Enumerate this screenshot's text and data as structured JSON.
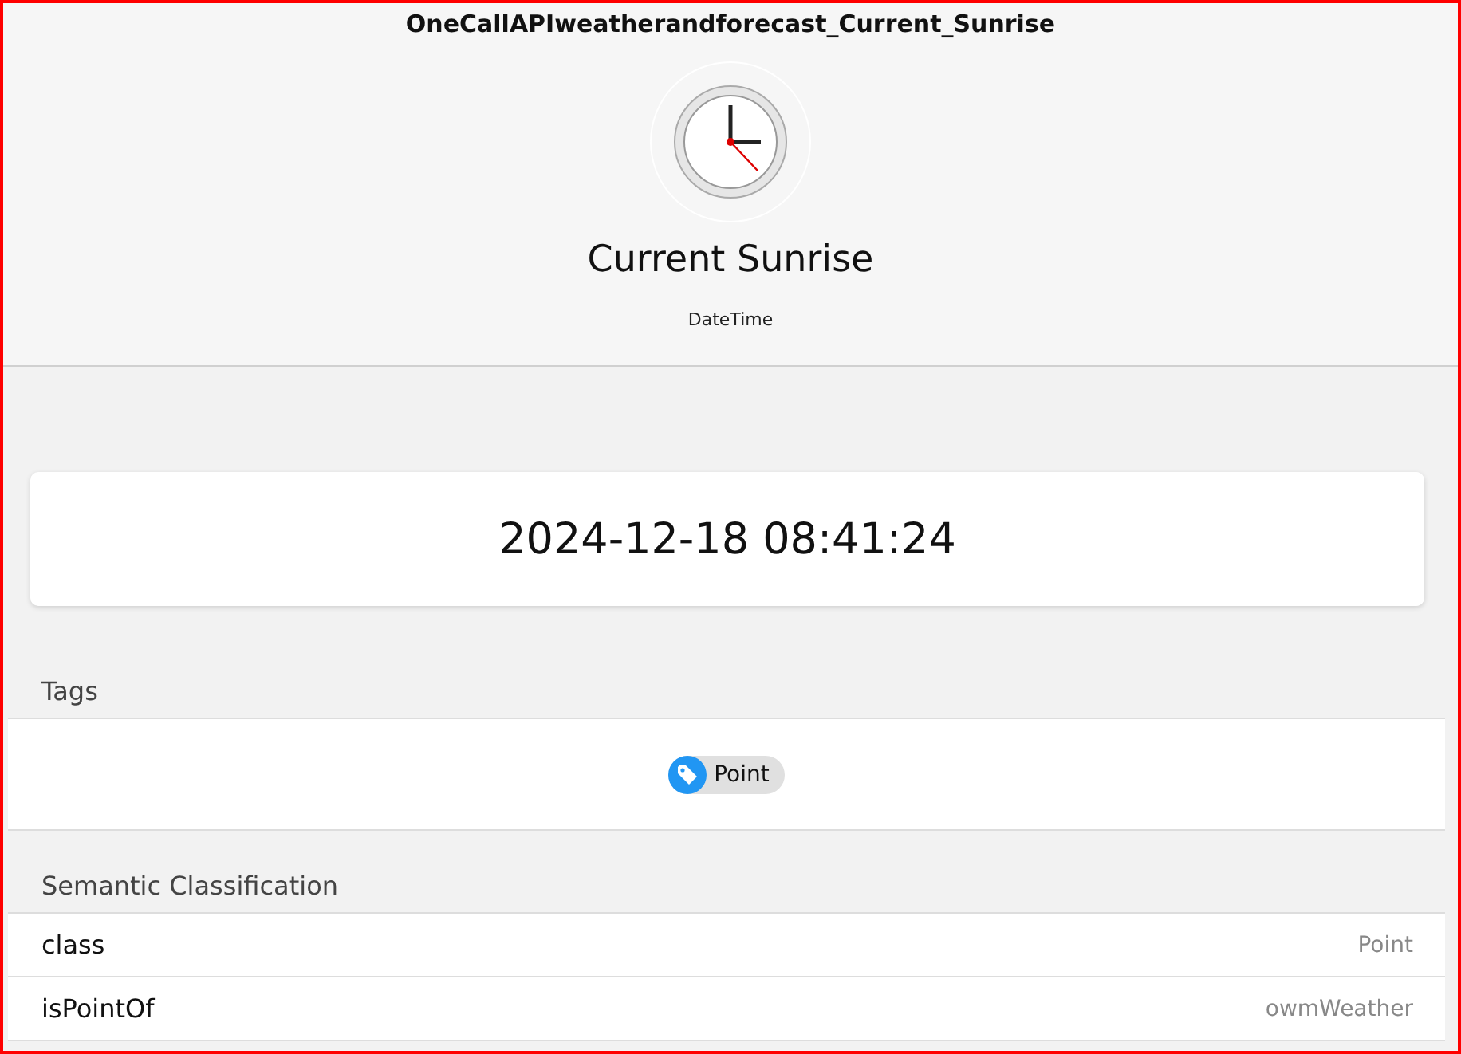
{
  "window": {
    "title": "OneCallAPIweatherandforecast_Current_Sunrise"
  },
  "header": {
    "name": "Current Sunrise",
    "type": "DateTime"
  },
  "value": "2024-12-18 08:41:24",
  "tags": {
    "heading": "Tags",
    "items": [
      {
        "label": "Point"
      }
    ]
  },
  "semantic": {
    "heading": "Semantic Classification",
    "rows": [
      {
        "key": "class",
        "value": "Point"
      },
      {
        "key": "isPointOf",
        "value": "owmWeather"
      }
    ]
  }
}
